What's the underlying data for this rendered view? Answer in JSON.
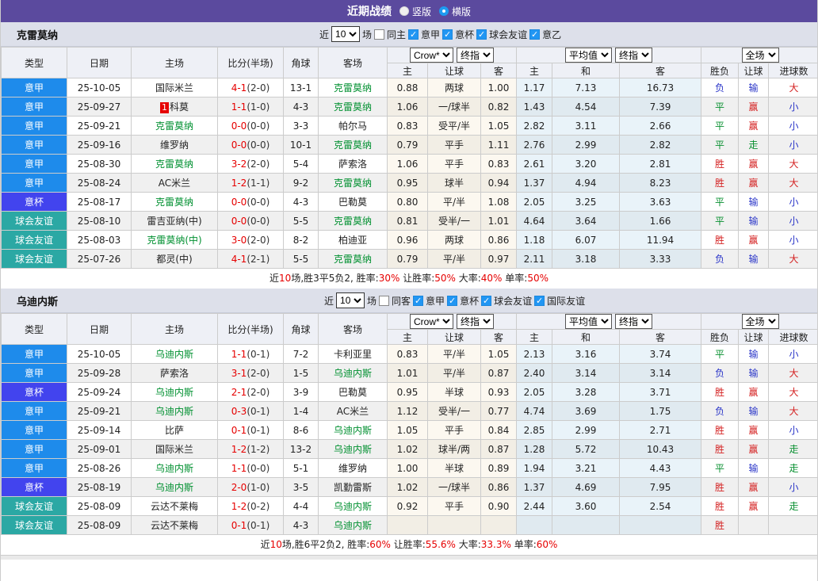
{
  "title_bar": {
    "title": "近期战绩",
    "radios": [
      {
        "label": "竖版",
        "selected": false
      },
      {
        "label": "横版",
        "selected": true
      }
    ]
  },
  "colors": {
    "accent_purple": "#5b4a9e",
    "score_red": "#e60000",
    "focal_team_green": "#009030",
    "win_red": "#d42020",
    "draw_green": "#089030",
    "lose_blue": "#2a35c8",
    "type_colors": {
      "意甲": "#1e8beb",
      "意杯": "#4244ee",
      "球会友谊": "#2ba8a4"
    }
  },
  "table_header": {
    "left_columns": [
      "类型",
      "日期",
      "主场",
      "比分(半场)",
      "角球",
      "客场"
    ],
    "group1_selects": [
      "Crow*",
      "终指"
    ],
    "group2_selects": [
      "平均值",
      "终指"
    ],
    "group3_selects": [
      "全场"
    ],
    "sub_columns": [
      "主",
      "让球",
      "客",
      "主",
      "和",
      "客",
      "胜负",
      "让球",
      "进球数"
    ]
  },
  "result_color_map": {
    "胜": "r",
    "赢": "r",
    "大": "r",
    "平": "g",
    "走": "g",
    "负": "b",
    "输": "b",
    "小": "b"
  },
  "sections": [
    {
      "team": "克雷莫纳",
      "filter": {
        "prefix": "近",
        "select_value": "10",
        "suffix": "场",
        "unchecked_label": "同主",
        "checked_labels": [
          "意甲",
          "意杯",
          "球会友谊",
          "意乙"
        ]
      },
      "rows": [
        {
          "type": "意甲",
          "date": "25-10-05",
          "home": {
            "text": "国际米兰"
          },
          "score": {
            "ft": "4-1",
            "ht": "(2-0)"
          },
          "corners": "13-1",
          "away": {
            "text": "克雷莫纳",
            "green": true
          },
          "odds": [
            "0.88",
            "两球",
            "1.00"
          ],
          "avg": [
            "1.17",
            "7.13",
            "16.73"
          ],
          "res": [
            "负",
            "输",
            "大"
          ]
        },
        {
          "type": "意甲",
          "date": "25-09-27",
          "home": {
            "text": "科莫",
            "badge": "1"
          },
          "score": {
            "ft": "1-1",
            "ht": "(1-0)"
          },
          "corners": "4-3",
          "away": {
            "text": "克雷莫纳",
            "green": true
          },
          "odds": [
            "1.06",
            "一/球半",
            "0.82"
          ],
          "avg": [
            "1.43",
            "4.54",
            "7.39"
          ],
          "res": [
            "平",
            "赢",
            "小"
          ]
        },
        {
          "type": "意甲",
          "date": "25-09-21",
          "home": {
            "text": "克雷莫纳",
            "green": true
          },
          "score": {
            "ft": "0-0",
            "ht": "(0-0)"
          },
          "corners": "3-3",
          "away": {
            "text": "帕尔马"
          },
          "odds": [
            "0.83",
            "受平/半",
            "1.05"
          ],
          "avg": [
            "2.82",
            "3.11",
            "2.66"
          ],
          "res": [
            "平",
            "赢",
            "小"
          ]
        },
        {
          "type": "意甲",
          "date": "25-09-16",
          "home": {
            "text": "维罗纳"
          },
          "score": {
            "ft": "0-0",
            "ht": "(0-0)"
          },
          "corners": "10-1",
          "away": {
            "text": "克雷莫纳",
            "green": true
          },
          "odds": [
            "0.79",
            "平手",
            "1.11"
          ],
          "avg": [
            "2.76",
            "2.99",
            "2.82"
          ],
          "res": [
            "平",
            "走",
            "小"
          ]
        },
        {
          "type": "意甲",
          "date": "25-08-30",
          "home": {
            "text": "克雷莫纳",
            "green": true
          },
          "score": {
            "ft": "3-2",
            "ht": "(2-0)"
          },
          "corners": "5-4",
          "away": {
            "text": "萨索洛"
          },
          "odds": [
            "1.06",
            "平手",
            "0.83"
          ],
          "avg": [
            "2.61",
            "3.20",
            "2.81"
          ],
          "res": [
            "胜",
            "赢",
            "大"
          ]
        },
        {
          "type": "意甲",
          "date": "25-08-24",
          "home": {
            "text": "AC米兰"
          },
          "score": {
            "ft": "1-2",
            "ht": "(1-1)"
          },
          "corners": "9-2",
          "away": {
            "text": "克雷莫纳",
            "green": true
          },
          "odds": [
            "0.95",
            "球半",
            "0.94"
          ],
          "avg": [
            "1.37",
            "4.94",
            "8.23"
          ],
          "res": [
            "胜",
            "赢",
            "大"
          ]
        },
        {
          "type": "意杯",
          "date": "25-08-17",
          "home": {
            "text": "克雷莫纳",
            "green": true
          },
          "score": {
            "ft": "0-0",
            "ht": "(0-0)"
          },
          "corners": "4-3",
          "away": {
            "text": "巴勒莫"
          },
          "odds": [
            "0.80",
            "平/半",
            "1.08"
          ],
          "avg": [
            "2.05",
            "3.25",
            "3.63"
          ],
          "res": [
            "平",
            "输",
            "小"
          ]
        },
        {
          "type": "球会友谊",
          "date": "25-08-10",
          "home": {
            "text": "雷吉亚纳(中)"
          },
          "score": {
            "ft": "0-0",
            "ht": "(0-0)"
          },
          "corners": "5-5",
          "away": {
            "text": "克雷莫纳",
            "green": true
          },
          "odds": [
            "0.81",
            "受半/一",
            "1.01"
          ],
          "avg": [
            "4.64",
            "3.64",
            "1.66"
          ],
          "res": [
            "平",
            "输",
            "小"
          ]
        },
        {
          "type": "球会友谊",
          "date": "25-08-03",
          "home": {
            "text": "克雷莫纳(中)",
            "green": true
          },
          "score": {
            "ft": "3-0",
            "ht": "(2-0)"
          },
          "corners": "8-2",
          "away": {
            "text": "柏迪亚"
          },
          "odds": [
            "0.96",
            "两球",
            "0.86"
          ],
          "avg": [
            "1.18",
            "6.07",
            "11.94"
          ],
          "res": [
            "胜",
            "赢",
            "小"
          ]
        },
        {
          "type": "球会友谊",
          "date": "25-07-26",
          "home": {
            "text": "都灵(中)"
          },
          "score": {
            "ft": "4-1",
            "ht": "(2-1)"
          },
          "corners": "5-5",
          "away": {
            "text": "克雷莫纳",
            "green": true
          },
          "odds": [
            "0.79",
            "平/半",
            "0.97"
          ],
          "avg": [
            "2.11",
            "3.18",
            "3.33"
          ],
          "res": [
            "负",
            "输",
            "大"
          ]
        }
      ],
      "summary": [
        {
          "text": "近",
          "red": false
        },
        {
          "text": "10",
          "red": true
        },
        {
          "text": "场,胜3平5负2, 胜率:",
          "red": false
        },
        {
          "text": "30%",
          "red": true
        },
        {
          "text": " 让胜率:",
          "red": false
        },
        {
          "text": "50%",
          "red": true
        },
        {
          "text": " 大率:",
          "red": false
        },
        {
          "text": "40%",
          "red": true
        },
        {
          "text": " 单率:",
          "red": false
        },
        {
          "text": "50%",
          "red": true
        }
      ]
    },
    {
      "team": "乌迪内斯",
      "filter": {
        "prefix": "近",
        "select_value": "10",
        "suffix": "场",
        "unchecked_label": "同客",
        "checked_labels": [
          "意甲",
          "意杯",
          "球会友谊",
          "国际友谊"
        ]
      },
      "rows": [
        {
          "type": "意甲",
          "date": "25-10-05",
          "home": {
            "text": "乌迪内斯",
            "green": true
          },
          "score": {
            "ft": "1-1",
            "ht": "(0-1)"
          },
          "corners": "7-2",
          "away": {
            "text": "卡利亚里"
          },
          "odds": [
            "0.83",
            "平/半",
            "1.05"
          ],
          "avg": [
            "2.13",
            "3.16",
            "3.74"
          ],
          "res": [
            "平",
            "输",
            "小"
          ]
        },
        {
          "type": "意甲",
          "date": "25-09-28",
          "home": {
            "text": "萨索洛"
          },
          "score": {
            "ft": "3-1",
            "ht": "(2-0)"
          },
          "corners": "1-5",
          "away": {
            "text": "乌迪内斯",
            "green": true
          },
          "odds": [
            "1.01",
            "平/半",
            "0.87"
          ],
          "avg": [
            "2.40",
            "3.14",
            "3.14"
          ],
          "res": [
            "负",
            "输",
            "大"
          ]
        },
        {
          "type": "意杯",
          "date": "25-09-24",
          "home": {
            "text": "乌迪内斯",
            "green": true
          },
          "score": {
            "ft": "2-1",
            "ht": "(2-0)"
          },
          "corners": "3-9",
          "away": {
            "text": "巴勒莫"
          },
          "odds": [
            "0.95",
            "半球",
            "0.93"
          ],
          "avg": [
            "2.05",
            "3.28",
            "3.71"
          ],
          "res": [
            "胜",
            "赢",
            "大"
          ]
        },
        {
          "type": "意甲",
          "date": "25-09-21",
          "home": {
            "text": "乌迪内斯",
            "green": true
          },
          "score": {
            "ft": "0-3",
            "ht": "(0-1)"
          },
          "corners": "1-4",
          "away": {
            "text": "AC米兰"
          },
          "odds": [
            "1.12",
            "受半/一",
            "0.77"
          ],
          "avg": [
            "4.74",
            "3.69",
            "1.75"
          ],
          "res": [
            "负",
            "输",
            "大"
          ]
        },
        {
          "type": "意甲",
          "date": "25-09-14",
          "home": {
            "text": "比萨"
          },
          "score": {
            "ft": "0-1",
            "ht": "(0-1)"
          },
          "corners": "8-6",
          "away": {
            "text": "乌迪内斯",
            "green": true
          },
          "odds": [
            "1.05",
            "平手",
            "0.84"
          ],
          "avg": [
            "2.85",
            "2.99",
            "2.71"
          ],
          "res": [
            "胜",
            "赢",
            "小"
          ]
        },
        {
          "type": "意甲",
          "date": "25-09-01",
          "home": {
            "text": "国际米兰"
          },
          "score": {
            "ft": "1-2",
            "ht": "(1-2)"
          },
          "corners": "13-2",
          "away": {
            "text": "乌迪内斯",
            "green": true
          },
          "odds": [
            "1.02",
            "球半/两",
            "0.87"
          ],
          "avg": [
            "1.28",
            "5.72",
            "10.43"
          ],
          "res": [
            "胜",
            "赢",
            "走"
          ]
        },
        {
          "type": "意甲",
          "date": "25-08-26",
          "home": {
            "text": "乌迪内斯",
            "green": true
          },
          "score": {
            "ft": "1-1",
            "ht": "(0-0)"
          },
          "corners": "5-1",
          "away": {
            "text": "维罗纳"
          },
          "odds": [
            "1.00",
            "半球",
            "0.89"
          ],
          "avg": [
            "1.94",
            "3.21",
            "4.43"
          ],
          "res": [
            "平",
            "输",
            "走"
          ]
        },
        {
          "type": "意杯",
          "date": "25-08-19",
          "home": {
            "text": "乌迪内斯",
            "green": true
          },
          "score": {
            "ft": "2-0",
            "ht": "(1-0)"
          },
          "corners": "3-5",
          "away": {
            "text": "凯勤雷斯"
          },
          "odds": [
            "1.02",
            "一/球半",
            "0.86"
          ],
          "avg": [
            "1.37",
            "4.69",
            "7.95"
          ],
          "res": [
            "胜",
            "赢",
            "小"
          ]
        },
        {
          "type": "球会友谊",
          "date": "25-08-09",
          "home": {
            "text": "云达不莱梅"
          },
          "score": {
            "ft": "1-2",
            "ht": "(0-2)"
          },
          "corners": "4-4",
          "away": {
            "text": "乌迪内斯",
            "green": true
          },
          "odds": [
            "0.92",
            "平手",
            "0.90"
          ],
          "avg": [
            "2.44",
            "3.60",
            "2.54"
          ],
          "res": [
            "胜",
            "赢",
            "走"
          ]
        },
        {
          "type": "球会友谊",
          "date": "25-08-09",
          "home": {
            "text": "云达不莱梅"
          },
          "score": {
            "ft": "0-1",
            "ht": "(0-1)"
          },
          "corners": "4-3",
          "away": {
            "text": "乌迪内斯",
            "green": true
          },
          "odds": [
            "",
            "",
            ""
          ],
          "avg": [
            "",
            "",
            ""
          ],
          "res": [
            "胜",
            "",
            ""
          ]
        }
      ],
      "summary": [
        {
          "text": "近",
          "red": false
        },
        {
          "text": "10",
          "red": true
        },
        {
          "text": "场,胜6平2负2, 胜率:",
          "red": false
        },
        {
          "text": "60%",
          "red": true
        },
        {
          "text": " 让胜率:",
          "red": false
        },
        {
          "text": "55.6%",
          "red": true
        },
        {
          "text": " 大率:",
          "red": false
        },
        {
          "text": "33.3%",
          "red": true
        },
        {
          "text": " 单率:",
          "red": false
        },
        {
          "text": "60%",
          "red": true
        }
      ]
    }
  ]
}
